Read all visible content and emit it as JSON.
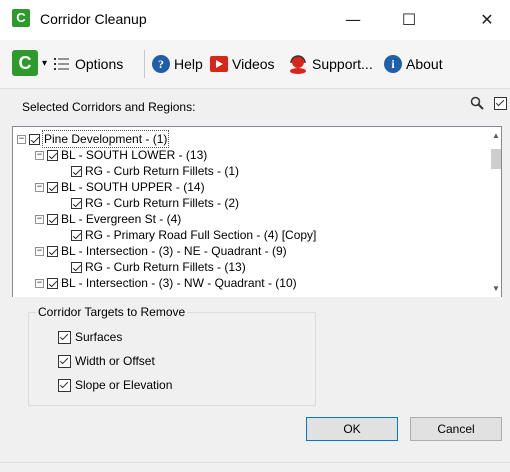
{
  "window": {
    "title": "Corridor Cleanup",
    "minimize": "—",
    "maximize": "☐",
    "close": "✕"
  },
  "toolbar": {
    "app_icon_letter": "C",
    "menu_caret": "▾",
    "options": "Options",
    "help": "Help",
    "videos": "Videos",
    "support": "Support...",
    "about": "About"
  },
  "section": {
    "label": "Selected Corridors and Regions:"
  },
  "tree": {
    "rows": [
      {
        "label": "Pine Development - (1)",
        "expander": "−",
        "checked": true
      },
      {
        "label": "BL - SOUTH LOWER - (13)",
        "expander": "−",
        "checked": true
      },
      {
        "label": "RG - Curb Return Fillets - (1)",
        "expander": "",
        "checked": true
      },
      {
        "label": "BL - SOUTH UPPER - (14)",
        "expander": "−",
        "checked": true
      },
      {
        "label": "RG - Curb Return Fillets - (2)",
        "expander": "",
        "checked": true
      },
      {
        "label": "BL - Evergreen St - (4)",
        "expander": "−",
        "checked": true
      },
      {
        "label": "RG - Primary Road Full Section - (4) [Copy]",
        "expander": "",
        "checked": true
      },
      {
        "label": "BL - Intersection - (3) - NE - Quadrant - (9)",
        "expander": "−",
        "checked": true
      },
      {
        "label": "RG - Curb Return Fillets - (13)",
        "expander": "",
        "checked": true
      },
      {
        "label": "BL - Intersection - (3) - NW - Quadrant - (10)",
        "expander": "−",
        "checked": true
      }
    ]
  },
  "targets": {
    "title": "Corridor Targets to Remove",
    "surfaces": "Surfaces",
    "width_offset": "Width or Offset",
    "slope_elevation": "Slope or Elevation"
  },
  "buttons": {
    "ok": "OK",
    "cancel": "Cancel"
  },
  "colors": {
    "app_green": "#2e9a2e",
    "help_blue": "#1e5fa8",
    "videos_red": "#d9261c",
    "support_red": "#d9261c",
    "about_blue": "#1e5fa8"
  }
}
